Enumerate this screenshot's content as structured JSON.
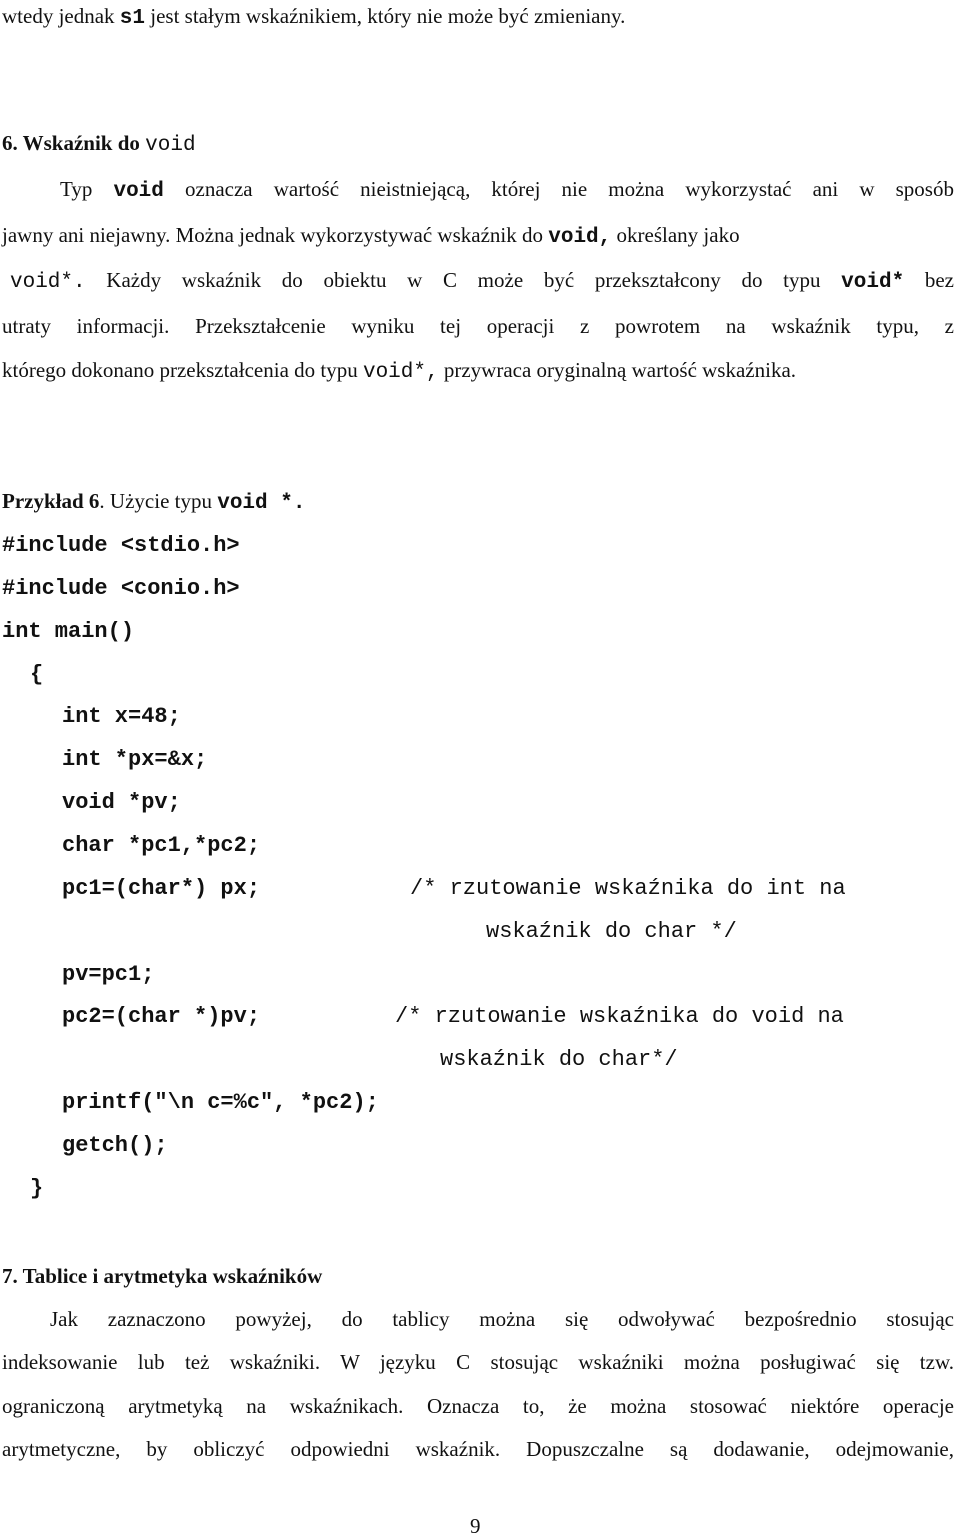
{
  "intro": {
    "pre": "wtedy jednak ",
    "code": "s1",
    "post": " jest stałym wskaźnikiem, który nie może być zmieniany."
  },
  "section6": {
    "heading_prefix": "6. Wskaźnik do ",
    "heading_code": "void",
    "p1": {
      "l1_a": "Typ ",
      "l1_code": "void",
      "l1_b": " oznacza wartość nieistniejącą, której nie można wykorzystać ani w sposób",
      "l2_a": "jawny ani niejawny. Można jednak wykorzystywać wskaźnik do ",
      "l2_code": "void,",
      "l2_b": " określany jako",
      "l3_code1": "void*.",
      "l3_b": " Każdy wskaźnik do obiektu w C może być przekształcony do typu ",
      "l3_code2": "void*",
      "l3_c": " bez",
      "l4": "utraty informacji. Przekształcenie wyniku tej operacji z powrotem na wskaźnik typu, z",
      "l5_a": "którego dokonano przekształcenia do typu ",
      "l5_code": "void*,",
      "l5_b": " przywraca oryginalną wartość wskaźnika."
    }
  },
  "example6": {
    "label_bold": "Przykład 6",
    "label_rest": ". Użycie typu ",
    "label_code": "void *.",
    "code_lines": [
      "#include <stdio.h>",
      "#include <conio.h>",
      "int main()",
      "{",
      "int x=48;",
      "int *px=&x;",
      "void *pv;",
      "char *pc1,*pc2;",
      "pc1=(char*) px;",
      "pv=pc1;",
      "pc2=(char *)pv;",
      "printf(\"\\n c=%c\", *pc2);",
      "getch();",
      "}"
    ],
    "comments": [
      {
        "line1": "/* rzutowanie wskaźnika do int na",
        "line2": "wskaźnik do char */"
      },
      {
        "line1": "/* rzutowanie wskaźnika do void na",
        "line2": "wskaźnik do char*/"
      }
    ]
  },
  "section7": {
    "heading": "7. Tablice i arytmetyka wskaźników",
    "lines": [
      "Jak zaznaczono powyżej, do tablicy można się odwoływać bezpośrednio stosując",
      "indeksowanie lub też wskaźniki. W języku C stosując wskaźniki można posługiwać się tzw.",
      "ograniczoną arytmetyką na wskaźnikach. Oznacza to, że można stosować niektóre operacje",
      "arytmetyczne, by obliczyć odpowiedni wskaźnik. Dopuszczalne są dodawanie, odejmowanie,"
    ]
  },
  "page_number": "9"
}
